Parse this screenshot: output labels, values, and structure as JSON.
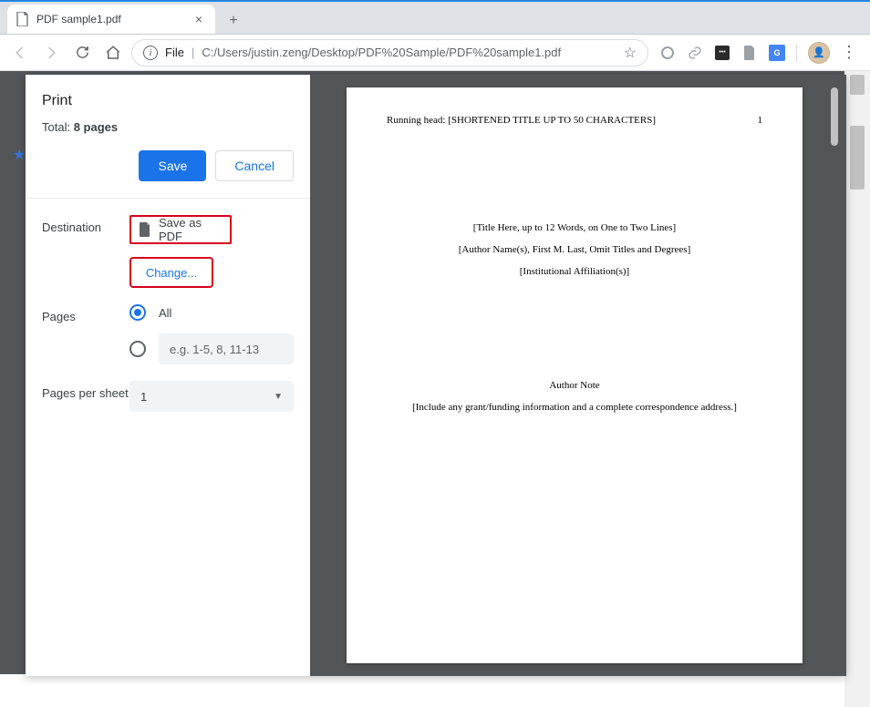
{
  "window": {
    "tab_title": "PDF sample1.pdf",
    "minimize": "—",
    "maximize": "☐",
    "close": "✕",
    "new_tab": "+",
    "tab_close": "×"
  },
  "toolbar": {
    "address_prefix": "File",
    "address_path": "C:/Users/justin.zeng/Desktop/PDF%20Sample/PDF%20sample1.pdf",
    "info_i": "i",
    "pipe": "|"
  },
  "print": {
    "title": "Print",
    "total_prefix": "Total: ",
    "total_value": "8 pages",
    "save": "Save",
    "cancel": "Cancel",
    "destination_label": "Destination",
    "destination_value": "Save as PDF",
    "change": "Change...",
    "pages_label": "Pages",
    "pages_all": "All",
    "pages_range_placeholder": "e.g. 1-5, 8, 11-13",
    "pps_label": "Pages per sheet",
    "pps_value": "1"
  },
  "doc": {
    "running_head": "Running head: [SHORTENED TITLE UP TO 50 CHARACTERS]",
    "page_no": "1",
    "title_line": "[Title Here, up to 12 Words, on One to Two Lines]",
    "author_line": "[Author Name(s), First M. Last, Omit Titles and Degrees]",
    "affil_line": "[Institutional Affiliation(s)]",
    "author_note": "Author Note",
    "grant_line": "[Include any grant/funding information and a complete correspondence address.]"
  }
}
